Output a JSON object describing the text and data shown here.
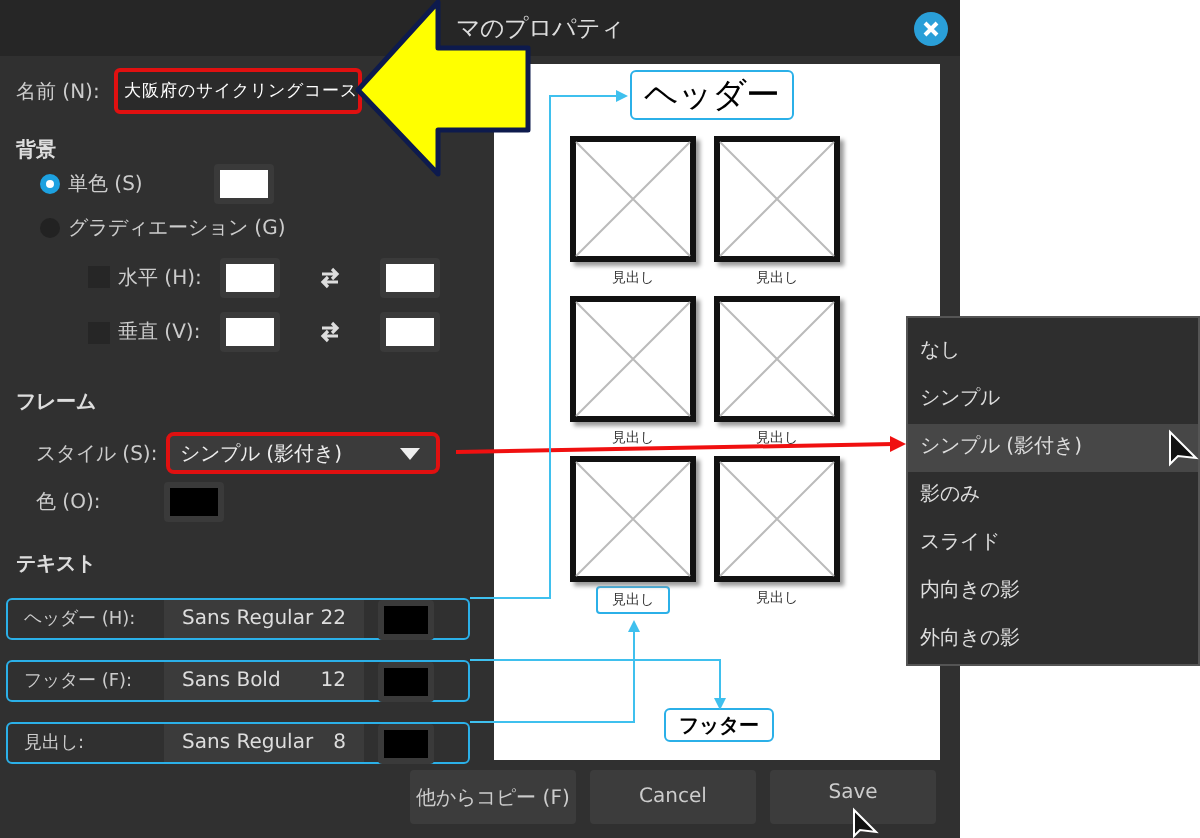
{
  "window": {
    "title": "マのプロパティ"
  },
  "name_field": {
    "label": "名前 (N):",
    "value": "大阪府のサイクリングコース"
  },
  "background": {
    "heading": "背景",
    "options": [
      {
        "label": "単色 (S)",
        "selected": true
      },
      {
        "label": "グラディエーション (G)",
        "selected": false
      }
    ],
    "gradient_rows": [
      {
        "label": "水平 (H):",
        "checked": false
      },
      {
        "label": "垂直 (V):",
        "checked": false
      }
    ]
  },
  "frame": {
    "heading": "フレーム",
    "style_label": "スタイル (S):",
    "style_value": "シンプル (影付き)",
    "color_label": "色 (O):"
  },
  "text": {
    "heading": "テキスト",
    "rows": [
      {
        "label": "ヘッダー (H):",
        "font": "Sans Regular",
        "size": "22"
      },
      {
        "label": "フッター (F):",
        "font": "Sans Bold",
        "size": "12"
      },
      {
        "label": "見出し:",
        "font": "Sans Regular",
        "size": "8"
      }
    ]
  },
  "preview": {
    "header": "ヘッダー",
    "captions": [
      "見出し",
      "見出し",
      "見出し",
      "見出し",
      "見出し",
      "見出し"
    ],
    "footer": "フッター"
  },
  "style_menu": [
    {
      "label": "なし",
      "selected": false
    },
    {
      "label": "シンプル",
      "selected": false
    },
    {
      "label": "シンプル (影付き)",
      "selected": true
    },
    {
      "label": "影のみ",
      "selected": false
    },
    {
      "label": "スライド",
      "selected": false
    },
    {
      "label": "内向きの影",
      "selected": false
    },
    {
      "label": "外向きの影",
      "selected": false
    }
  ],
  "buttons": [
    "他からコピー (F)",
    "Cancel",
    "Save"
  ]
}
